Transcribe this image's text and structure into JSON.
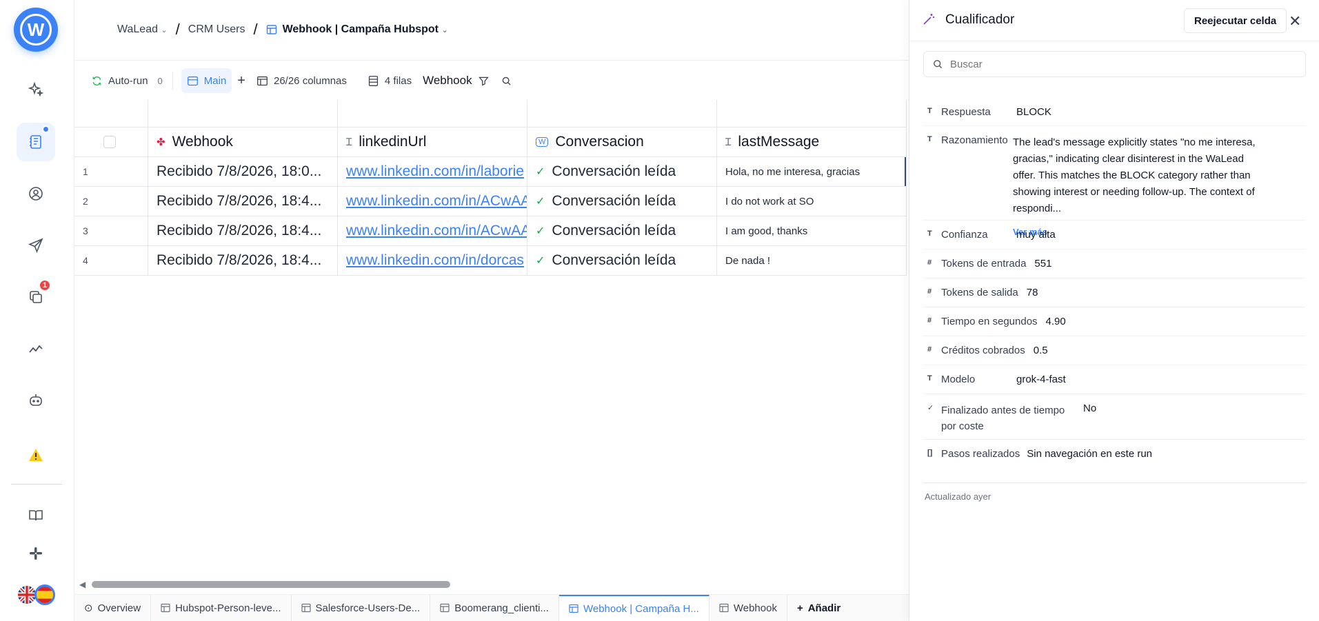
{
  "sidebar": {
    "logo_letter": "W",
    "notif_badge": "1"
  },
  "breadcrumb": {
    "workspace": "WaLead",
    "section": "CRM Users",
    "table": "Webhook | Campaña Hubspot"
  },
  "toolbar": {
    "autorun_label": "Auto-run",
    "autorun_count": "0",
    "view_label": "Main",
    "columns_label": "26/26 columnas",
    "rows_label": "4 filas",
    "filter_label": "Webhook"
  },
  "grid": {
    "headers": [
      "Webhook",
      "linkedinUrl",
      "Conversacion",
      "lastMessage"
    ],
    "rows": [
      {
        "n": "1",
        "webhook": "Recibido 7/8/2026, 18:0...",
        "url": "www.linkedin.com/in/laborie",
        "conv": "Conversación leída",
        "msg": "Hola, no me interesa, gracias"
      },
      {
        "n": "2",
        "webhook": "Recibido 7/8/2026, 18:4...",
        "url": "www.linkedin.com/in/ACwAA",
        "conv": "Conversación leída",
        "msg": "I do not work at SO"
      },
      {
        "n": "3",
        "webhook": "Recibido 7/8/2026, 18:4...",
        "url": "www.linkedin.com/in/ACwAA",
        "conv": "Conversación leída",
        "msg": "I am good, thanks"
      },
      {
        "n": "4",
        "webhook": "Recibido 7/8/2026, 18:4...",
        "url": "www.linkedin.com/in/dorcas",
        "conv": "Conversación leída",
        "msg": "De nada !"
      }
    ]
  },
  "tabs": [
    "Overview",
    "Hubspot-Person-leve...",
    "Salesforce-Users-De...",
    "Boomerang_clienti...",
    "Webhook | Campaña H...",
    "Webhook",
    "Añadir"
  ],
  "panel": {
    "title": "Cualificador",
    "rerun_label": "Reejecutar celda",
    "search_placeholder": "Buscar",
    "fields": [
      {
        "type": "T",
        "key": "Respuesta",
        "value": "BLOCK"
      },
      {
        "type": "T",
        "key": "Razonamiento",
        "value": "The lead's message explicitly states \"no me interesa, gracias,\" indicating clear disinterest in the WaLead offer. This matches the BLOCK category rather than showing interest or needing follow-up. The context of respondi...",
        "more": "Ver más"
      },
      {
        "type": "T",
        "key": "Confianza",
        "value": "muy alta"
      },
      {
        "type": "#",
        "key": "Tokens de entrada",
        "value": "551"
      },
      {
        "type": "#",
        "key": "Tokens de salida",
        "value": "78"
      },
      {
        "type": "#",
        "key": "Tiempo en segundos",
        "value": "4.90"
      },
      {
        "type": "#",
        "key": "Créditos cobrados",
        "value": "0.5"
      },
      {
        "type": "T",
        "key": "Modelo",
        "value": "grok-4-fast"
      },
      {
        "type": "✓",
        "key": "Finalizado antes de tiempo por coste",
        "value": "No"
      },
      {
        "type": "[]",
        "key": "Pasos realizados",
        "value": "Sin navegación en este run"
      }
    ],
    "updated": "Actualizado ayer"
  }
}
